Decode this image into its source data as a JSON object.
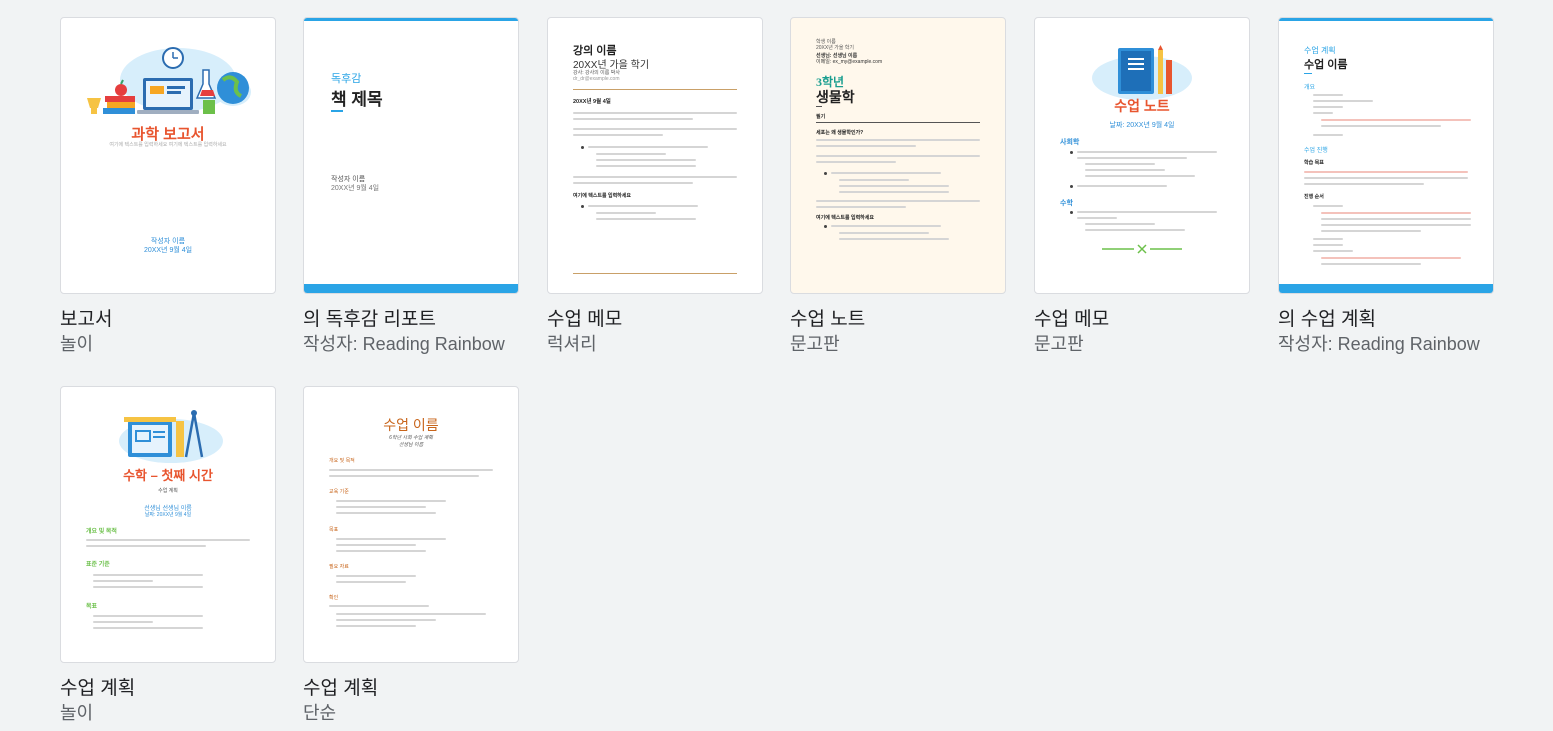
{
  "templates": [
    {
      "title": "보고서",
      "subtitle": "놀이",
      "preview": {
        "heading": "과학 보고서",
        "tagline": "여기에 텍스트를 입력하세요 여기에 텍스트를 입력하세요",
        "author": "작성자 이름",
        "date": "20XX년 9월 4일"
      }
    },
    {
      "title": "의 독후감 리포트",
      "subtitle": "작성자: Reading Rainbow",
      "preview": {
        "kicker": "독후감",
        "heading": "책 제목",
        "author": "작성자 이름",
        "date": "20XX년 9월 4일"
      }
    },
    {
      "title": "수업 메모",
      "subtitle": "럭셔리",
      "preview": {
        "heading": "강의 이름",
        "term": "20XX년 가을 학기",
        "meta1": "강사: 강사의 이름 박사",
        "meta2": "dr_dr@example.com",
        "date": "20XX년 9월 4일",
        "section": "여기에 텍스트를 입력하세요"
      }
    },
    {
      "title": "수업 노트",
      "subtitle": "문고판",
      "preview": {
        "meta1": "학생 이름",
        "meta2": "20XX년 가을 학기",
        "meta3": "선생님: 선생님 이름",
        "meta4": "이메일: ex_my@example.com",
        "kicker": "3학년",
        "heading": "생물학",
        "section1": "필기",
        "section2": "세포는 왜 생물학인가?",
        "section3": "여기에 텍스트를 입력하세요"
      }
    },
    {
      "title": "수업 메모",
      "subtitle": "문고판",
      "preview": {
        "heading": "수업 노트",
        "date": "날짜: 20XX년 9월 4일",
        "section1": "사회학",
        "section2": "수학"
      }
    },
    {
      "title": "의 수업 계획",
      "subtitle": "작성자: Reading Rainbow",
      "preview": {
        "kicker": "수업 계획",
        "heading": "수업 이름",
        "section1": "개요",
        "section2": "수업 진행",
        "section3": "학습 목표",
        "section4": "진행 순서"
      }
    },
    {
      "title": "수업 계획",
      "subtitle": "놀이",
      "preview": {
        "heading": "수학 – 첫째 시간",
        "label": "수업 계획",
        "teacher": "선생님 선생님 이름",
        "date": "날짜: 20XX년 9월 4일",
        "section1": "개요 및 목적",
        "section2": "표준 기준",
        "section3": "목표"
      }
    },
    {
      "title": "수업 계획",
      "subtitle": "단순",
      "preview": {
        "heading": "수업 이름",
        "sub1": "6학년 사회 수업 계획",
        "sub2": "선생님 이름",
        "section1": "개요 및 목적",
        "section2": "교육 기준",
        "section3": "목표",
        "section4": "필요 자료",
        "section5": "확인"
      }
    }
  ]
}
